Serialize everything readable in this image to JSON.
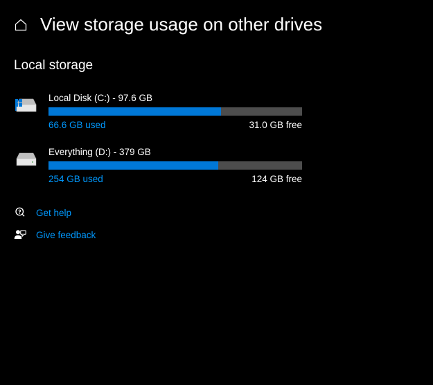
{
  "header": {
    "title": "View storage usage on other drives"
  },
  "section": {
    "title": "Local storage"
  },
  "drives": [
    {
      "label": "Local Disk (C:) - 97.6 GB",
      "used": "66.6 GB used",
      "free": "31.0 GB free",
      "percent": 68
    },
    {
      "label": "Everything (D:) - 379 GB",
      "used": "254 GB used",
      "free": "124 GB free",
      "percent": 67
    }
  ],
  "links": {
    "help": "Get help",
    "feedback": "Give feedback"
  }
}
